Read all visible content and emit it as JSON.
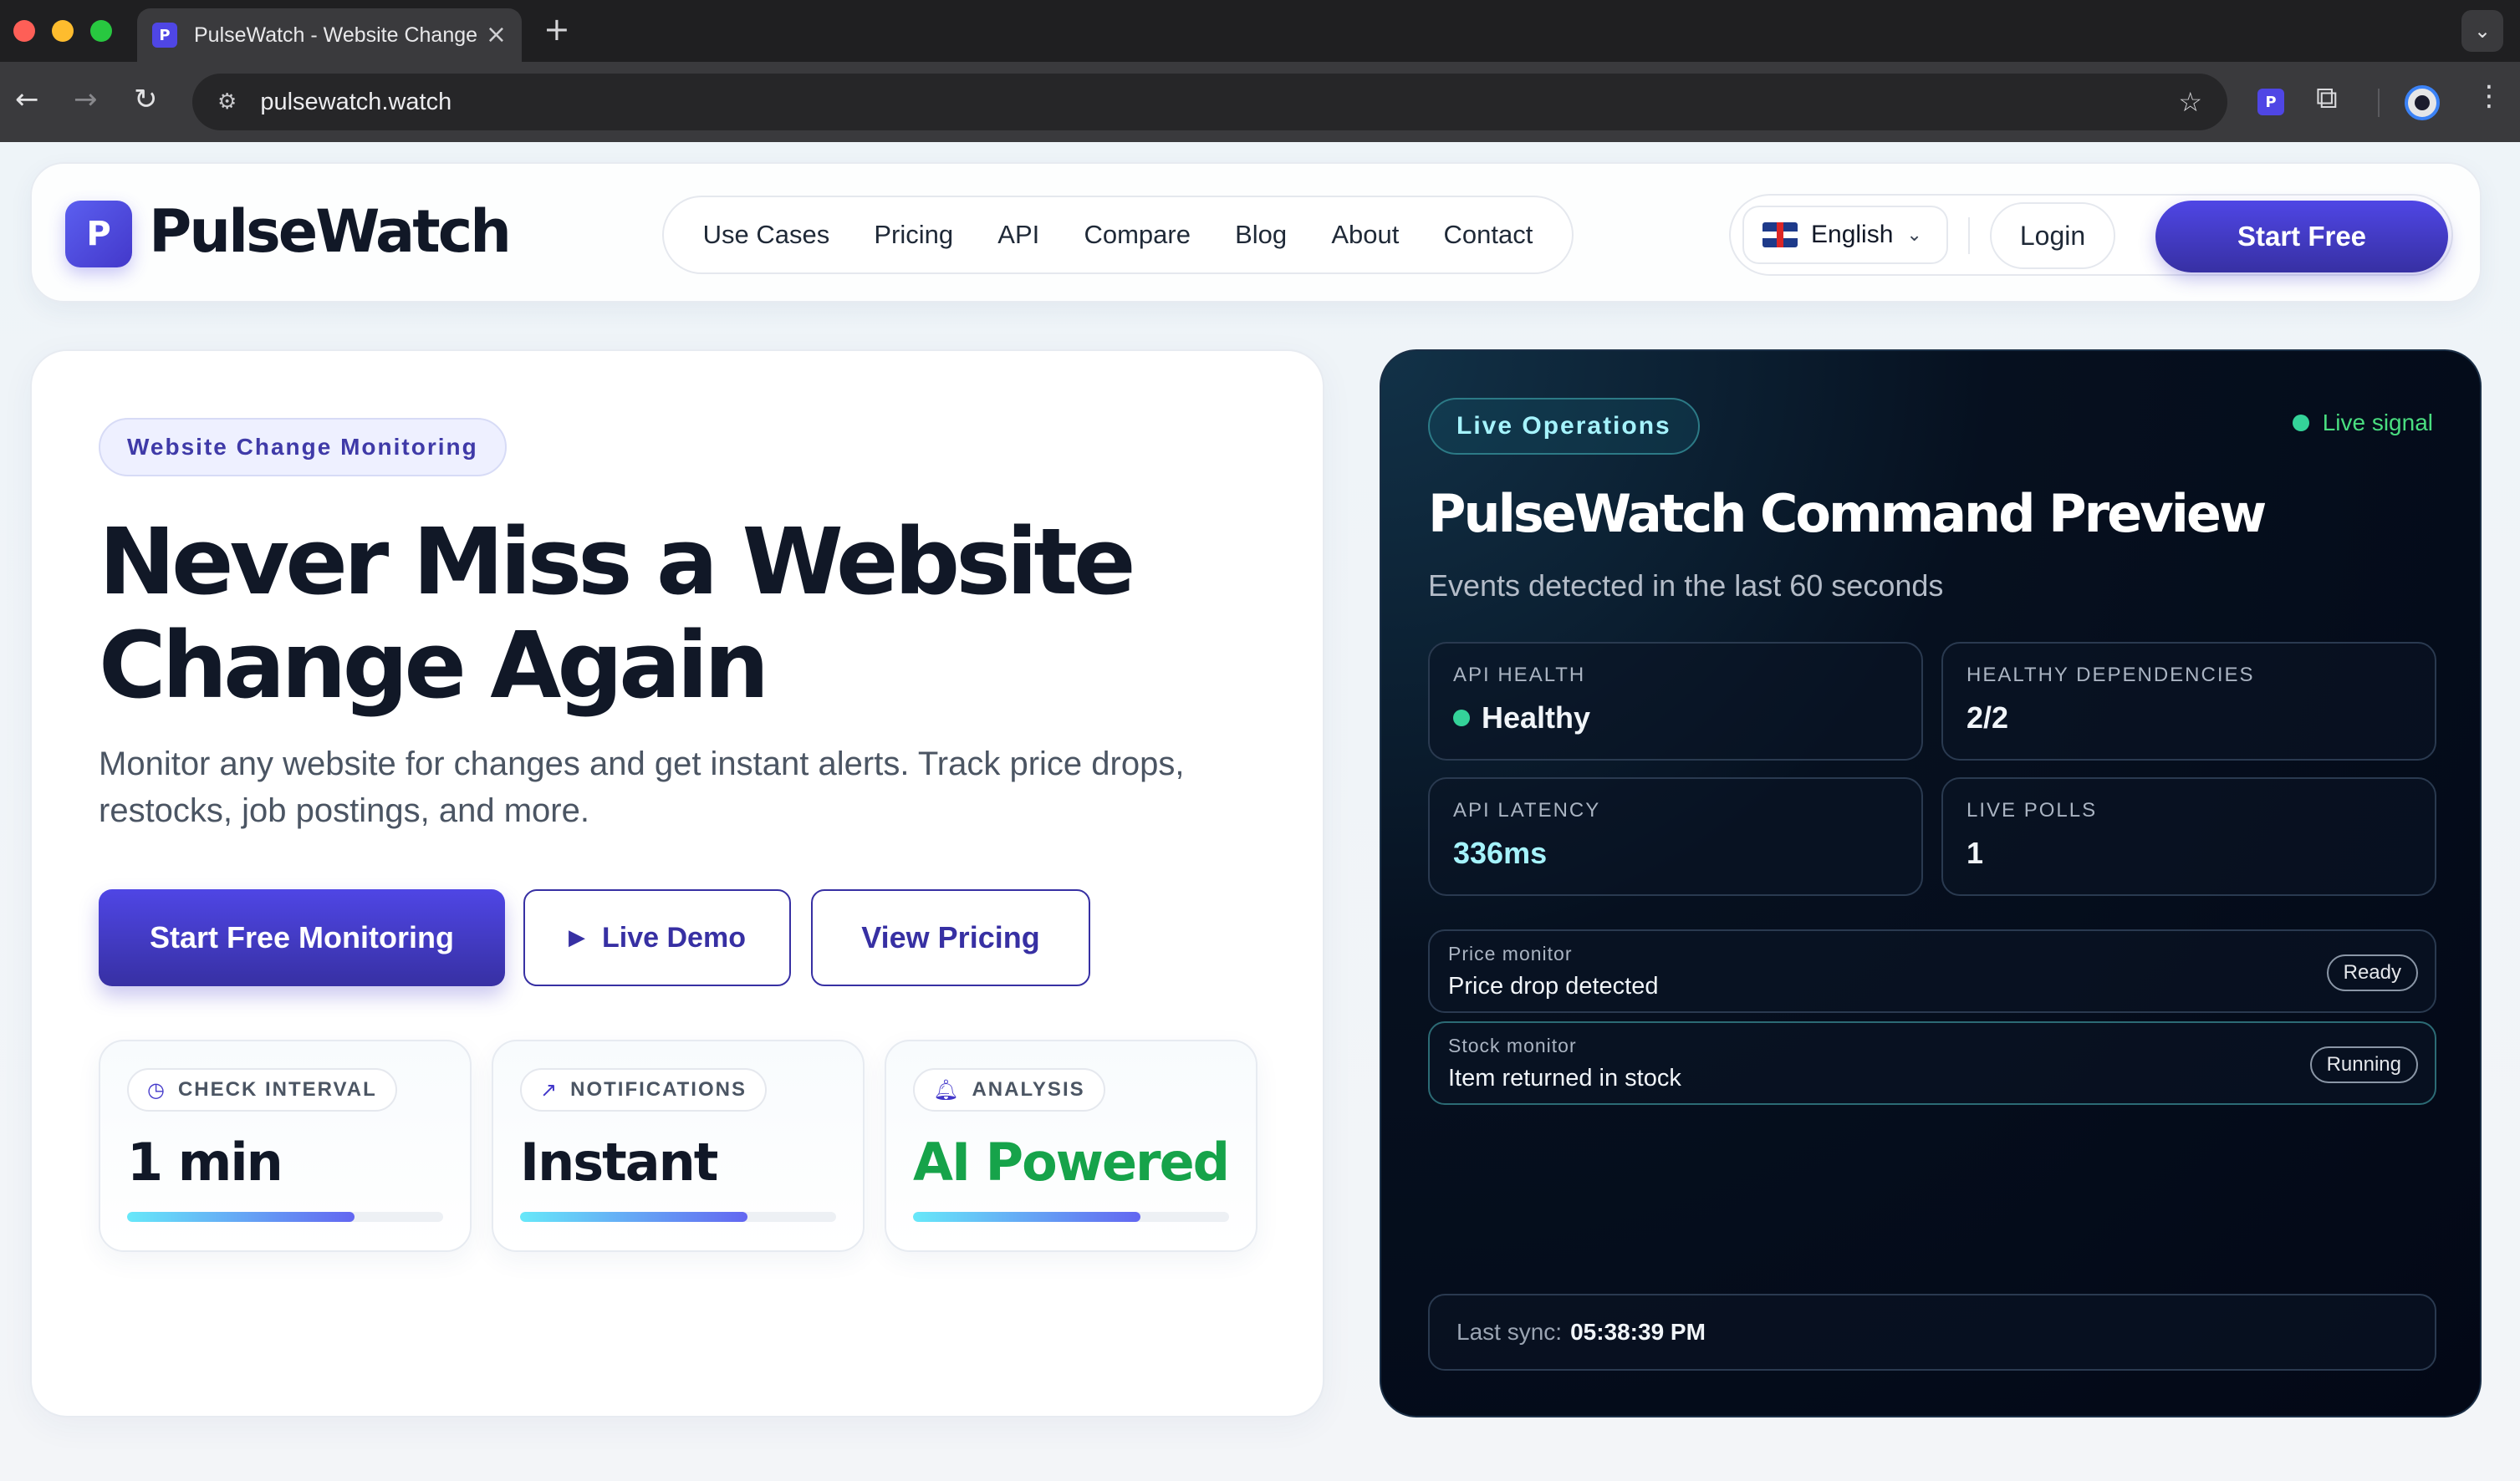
{
  "browser": {
    "tab_title": "PulseWatch - Website Change Monitoring",
    "tab_favicon": "P",
    "url": "pulsewatch.watch"
  },
  "header": {
    "logo_letter": "P",
    "brand": "PulseWatch",
    "nav": [
      {
        "label": "Use Cases"
      },
      {
        "label": "Pricing"
      },
      {
        "label": "API"
      },
      {
        "label": "Compare"
      },
      {
        "label": "Blog"
      },
      {
        "label": "About"
      },
      {
        "label": "Contact"
      }
    ],
    "language": "English",
    "login_label": "Login",
    "start_label": "Start Free"
  },
  "hero": {
    "badge": "Website Change Monitoring",
    "title_line1": "Never Miss a Website",
    "title_line2": "Change Again",
    "subtitle": "Monitor any website for changes and get instant alerts. Track price drops, restocks, job postings, and more.",
    "cta_primary": "Start Free Monitoring",
    "cta_demo": "Live Demo",
    "cta_pricing": "View Pricing",
    "stats": [
      {
        "label": "CHECK INTERVAL",
        "value": "1 min",
        "icon": "clock-icon",
        "progress": 0.72
      },
      {
        "label": "NOTIFICATIONS",
        "value": "Instant",
        "icon": "trending-up-icon",
        "progress": 0.72
      },
      {
        "label": "ANALYSIS",
        "value": "AI Powered",
        "icon": "bell-icon",
        "progress": 0.72
      }
    ]
  },
  "ops": {
    "badge": "Live Operations",
    "live_signal": "Live signal",
    "title": "PulseWatch Command Preview",
    "subtitle": "Events detected in the last 60 seconds",
    "metrics": [
      {
        "label": "API HEALTH",
        "value": "Healthy"
      },
      {
        "label": "HEALTHY DEPENDENCIES",
        "value": "2/2"
      },
      {
        "label": "API LATENCY",
        "value": "336ms"
      },
      {
        "label": "LIVE POLLS",
        "value": "1"
      }
    ],
    "events": [
      {
        "label": "Price monitor",
        "text": "Price drop detected",
        "status": "Ready"
      },
      {
        "label": "Stock monitor",
        "text": "Item returned in stock",
        "status": "Running"
      }
    ],
    "sync_label": "Last sync:",
    "sync_time": "05:38:39 PM"
  },
  "colors": {
    "brand": "#4f46e5",
    "ops_bg": "#030816",
    "live": "#34d399",
    "ai_green": "#16a34a"
  }
}
